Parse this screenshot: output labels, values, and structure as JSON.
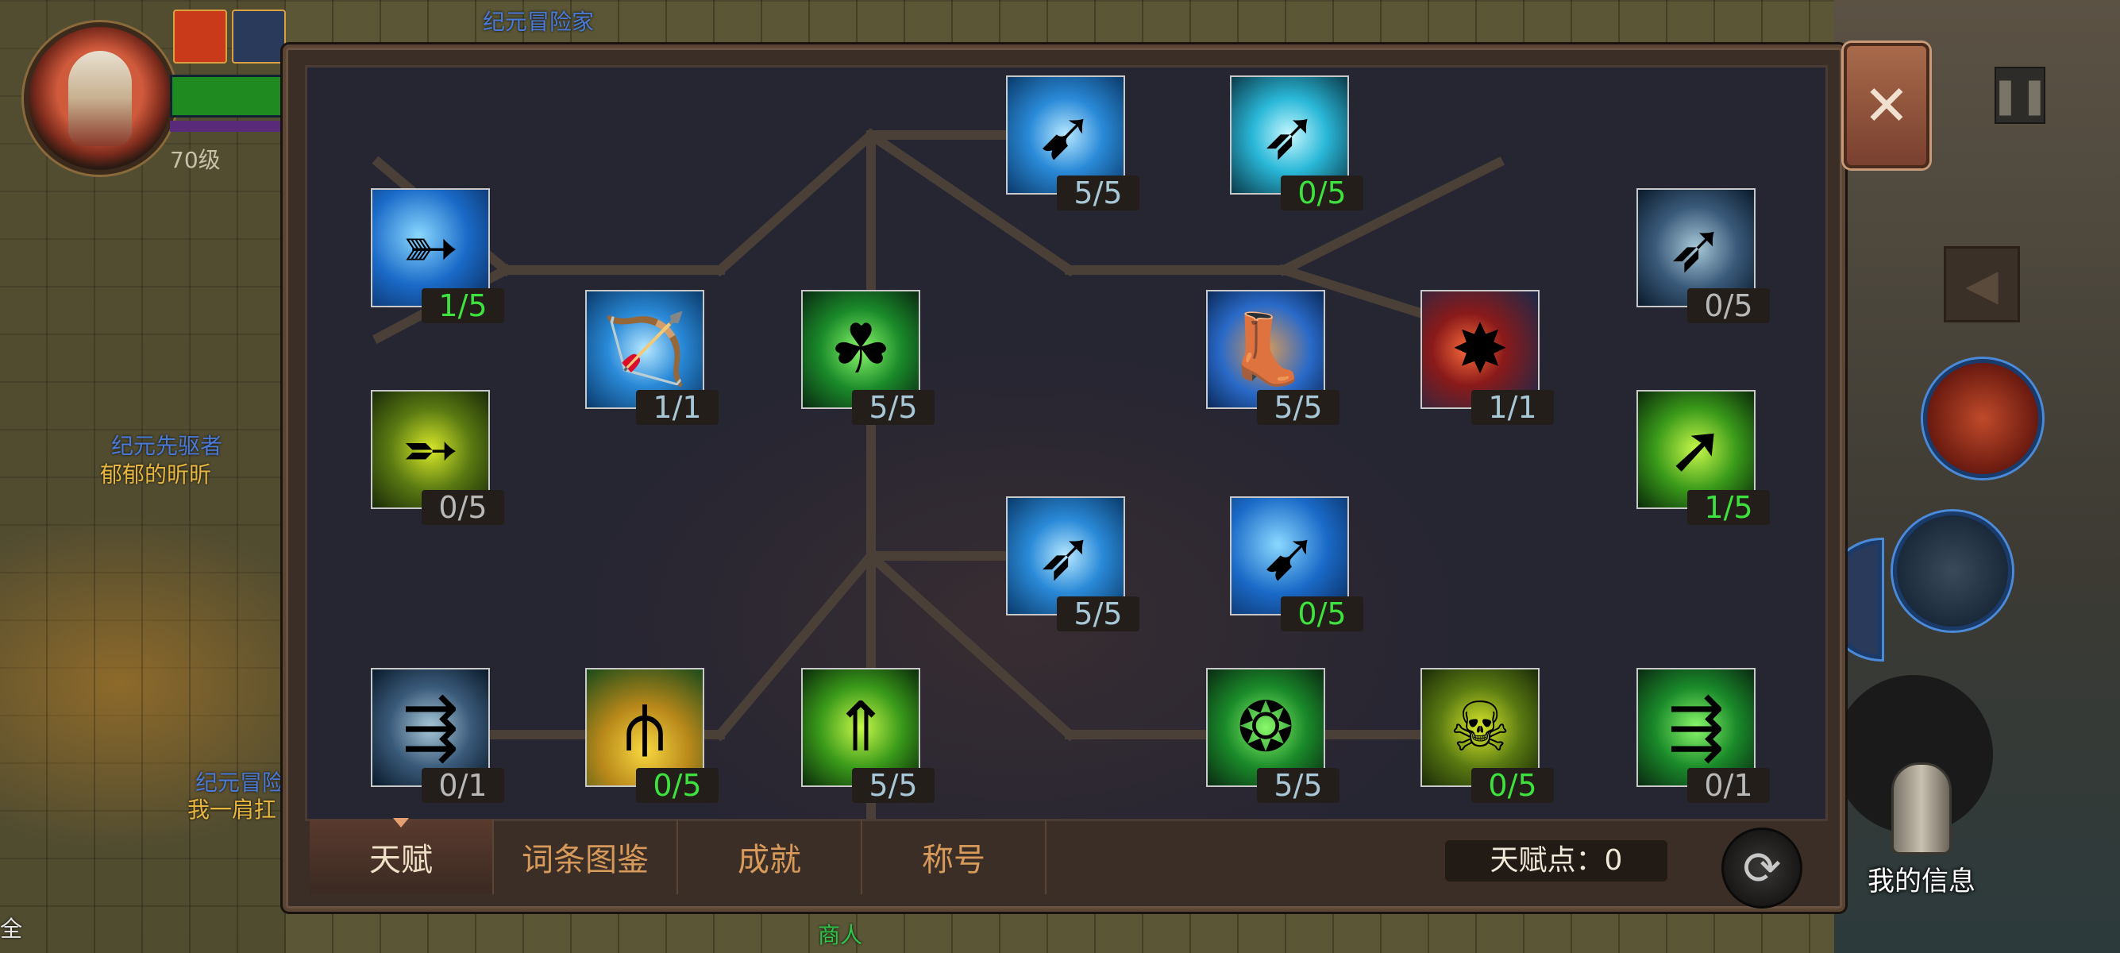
{
  "world": {
    "player_level": "70级",
    "names": [
      {
        "text": "纪元冒险家",
        "color": "blue"
      },
      {
        "text": "纪元先驱者",
        "color": "blue"
      },
      {
        "text": "郁郁的昕昕",
        "color": "yellow"
      },
      {
        "text": "纪元冒险",
        "color": "blue"
      },
      {
        "text": "我一肩扛",
        "color": "yellow"
      },
      {
        "text": "商人",
        "color": "green"
      },
      {
        "text": "全",
        "color": "white"
      }
    ]
  },
  "hud": {
    "my_info_label": "我的信息"
  },
  "talent_tree": {
    "nodes": [
      {
        "icon": "lightning-arrow-icon",
        "count": "1/5",
        "state": "on"
      },
      {
        "icon": "gold-arrow-icon",
        "count": "0/5",
        "state": "off"
      },
      {
        "icon": "ice-bow-icon",
        "count": "1/1",
        "state": "max"
      },
      {
        "icon": "green-leap-icon",
        "count": "5/5",
        "state": "max"
      },
      {
        "icon": "ice-arrowhead-icon",
        "count": "5/5",
        "state": "max"
      },
      {
        "icon": "spiral-arrow-icon",
        "count": "0/5",
        "state": "on"
      },
      {
        "icon": "swift-boot-icon",
        "count": "5/5",
        "state": "max"
      },
      {
        "icon": "fire-burst-arrow-icon",
        "count": "1/1",
        "state": "max"
      },
      {
        "icon": "wind-arrow-icon",
        "count": "0/5",
        "state": "off"
      },
      {
        "icon": "golden-spear-icon",
        "count": "1/5",
        "state": "on"
      },
      {
        "icon": "glowing-arrowhead-icon",
        "count": "5/5",
        "state": "max"
      },
      {
        "icon": "ice-spear-icon",
        "count": "0/5",
        "state": "on"
      },
      {
        "icon": "multi-arrow-icon",
        "count": "0/1",
        "state": "off"
      },
      {
        "icon": "triple-arrow-icon",
        "count": "0/5",
        "state": "on"
      },
      {
        "icon": "green-flame-arrow-icon",
        "count": "5/5",
        "state": "max"
      },
      {
        "icon": "nature-orb-icon",
        "count": "5/5",
        "state": "max"
      },
      {
        "icon": "hooded-ranger-icon",
        "count": "0/5",
        "state": "on"
      },
      {
        "icon": "green-volley-icon",
        "count": "0/1",
        "state": "off"
      }
    ]
  },
  "tabs": [
    {
      "label": "天赋",
      "active": true
    },
    {
      "label": "词条图鉴",
      "active": false
    },
    {
      "label": "成就",
      "active": false
    },
    {
      "label": "称号",
      "active": false
    }
  ],
  "talent_points": "天赋点：0",
  "colors": {
    "count_on": "#3ee23e",
    "count_max": "#a8c8d8",
    "count_off": "#b8b8b8",
    "tab_text": "#d89a5a"
  }
}
